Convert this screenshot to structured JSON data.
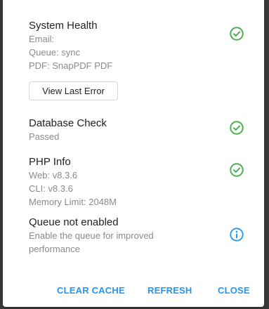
{
  "colors": {
    "success": "#4caf50",
    "info": "#2196f3",
    "title_text": "#222222",
    "detail_text": "#8a8a8a"
  },
  "system_health": {
    "title": "System Health",
    "lines": [
      "Email:",
      "Queue: sync",
      "PDF: SnapPDF PDF"
    ],
    "status_icon": "check-circle-icon",
    "view_error_label": "View Last Error"
  },
  "database_check": {
    "title": "Database Check",
    "lines": [
      "Passed"
    ],
    "status_icon": "check-circle-icon"
  },
  "php_info": {
    "title": "PHP Info",
    "lines": [
      "Web: v8.3.6",
      "CLI: v8.3.6",
      "Memory Limit: 2048M"
    ],
    "status_icon": "check-circle-icon"
  },
  "queue": {
    "title": "Queue not enabled",
    "lines": [
      "Enable the queue for improved",
      "performance"
    ],
    "status_icon": "info-circle-icon"
  },
  "footer": {
    "clear_cache_label": "CLEAR CACHE",
    "refresh_label": "REFRESH",
    "close_label": "CLOSE"
  }
}
